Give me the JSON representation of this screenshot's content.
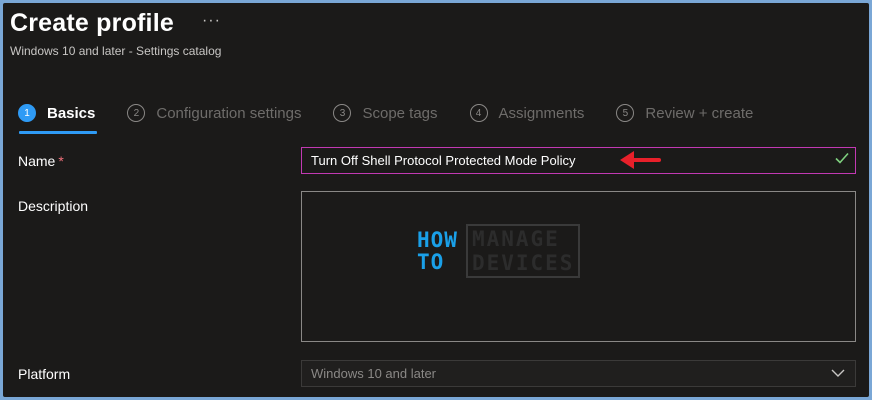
{
  "header": {
    "title": "Create profile",
    "more": "···",
    "subtitle": "Windows 10 and later - Settings catalog"
  },
  "steps": [
    {
      "num": "1",
      "label": "Basics",
      "active": true
    },
    {
      "num": "2",
      "label": "Configuration settings",
      "active": false
    },
    {
      "num": "3",
      "label": "Scope tags",
      "active": false
    },
    {
      "num": "4",
      "label": "Assignments",
      "active": false
    },
    {
      "num": "5",
      "label": "Review + create",
      "active": false
    }
  ],
  "form": {
    "name_label": "Name",
    "required_mark": "*",
    "name_value": "Turn Off Shell Protocol Protected Mode Policy",
    "description_label": "Description",
    "description_value": "",
    "platform_label": "Platform",
    "platform_value": "Windows 10 and later"
  },
  "watermark": {
    "how": "HOW",
    "to": "TO",
    "manage": "MANAGE",
    "devices": "DEVICES"
  },
  "colors": {
    "accent": "#2f9bf5",
    "focus_border": "#c239b3",
    "check": "#7fd07f",
    "annotation_arrow": "#e8202a"
  },
  "icons": {
    "valid": "check-icon",
    "annotation": "red-arrow-icon",
    "dropdown": "chevron-down-icon",
    "more": "ellipsis-icon"
  }
}
